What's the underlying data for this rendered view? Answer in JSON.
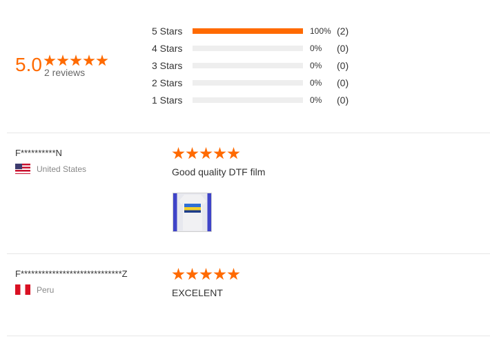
{
  "summary": {
    "score": "5.0",
    "reviews_label": "2 reviews",
    "star_icon": "star-icon",
    "accent_color": "#ff6a00"
  },
  "distribution": [
    {
      "label": "5 Stars",
      "fraction": 1.0,
      "percent": "100%",
      "count": "(2)"
    },
    {
      "label": "4 Stars",
      "fraction": 0.0,
      "percent": "0%",
      "count": "(0)"
    },
    {
      "label": "3 Stars",
      "fraction": 0.0,
      "percent": "0%",
      "count": "(0)"
    },
    {
      "label": "2 Stars",
      "fraction": 0.0,
      "percent": "0%",
      "count": "(0)"
    },
    {
      "label": "1 Stars",
      "fraction": 0.0,
      "percent": "0%",
      "count": "(0)"
    }
  ],
  "reviews": [
    {
      "name": "F**********N",
      "country": "United States",
      "flag_icon": "us-flag-icon",
      "rating": 5,
      "text": "Good quality DTF film",
      "has_photo": true
    },
    {
      "name": "F*****************************Z",
      "country": "Peru",
      "flag_icon": "peru-flag-icon",
      "rating": 5,
      "text": "EXCELENT",
      "has_photo": false
    }
  ]
}
